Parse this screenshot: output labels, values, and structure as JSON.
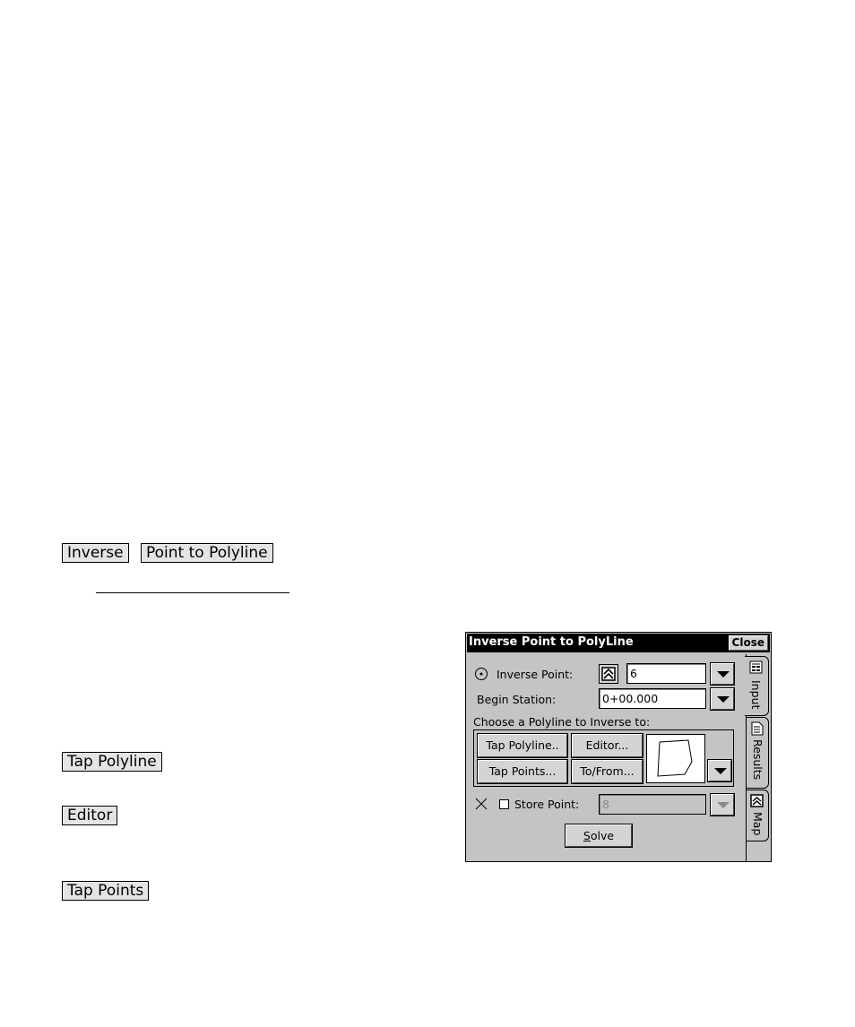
{
  "doc_keys": {
    "inverse": "Inverse",
    "point_to_polyline": "Point to Polyline",
    "tap_polyline": "Tap Polyline",
    "editor": "Editor",
    "tap_points": "Tap Points"
  },
  "dialog": {
    "title": "Inverse Point to PolyLine",
    "close": "Close",
    "inverse_point_label": "Inverse Point:",
    "inverse_point_value": "6",
    "begin_station_label": "Begin Station:",
    "begin_station_value": "0+00.000",
    "choose_label": "Choose a Polyline to Inverse to:",
    "btn_tap_polyline": "Tap Polyline..",
    "btn_editor": "Editor...",
    "btn_tap_points": "Tap Points...",
    "btn_to_from": "To/From...",
    "store_point_label": "Store Point:",
    "store_point_value": "8",
    "solve_label": "Solve",
    "tabs": [
      "Input",
      "Results",
      "Map"
    ]
  }
}
